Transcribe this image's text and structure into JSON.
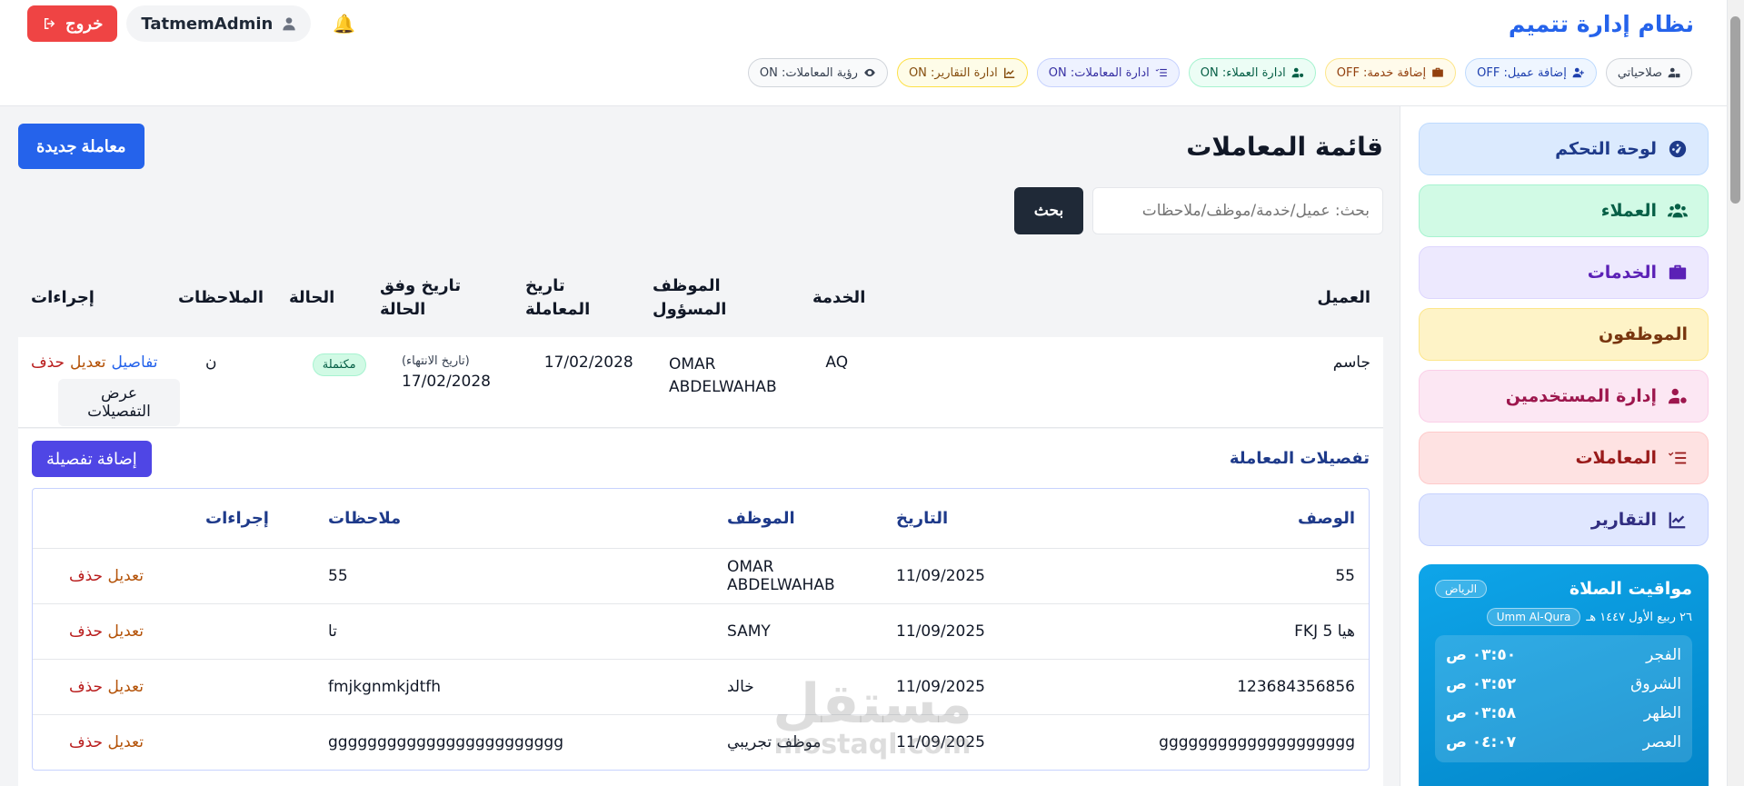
{
  "app": {
    "title": "نظام إدارة تتميم"
  },
  "header": {
    "logout_label": "خروج",
    "username": "TatmemAdmin",
    "permissions": [
      {
        "label": "صلاحياتي",
        "style": "gray",
        "icon": "user-lock-icon"
      },
      {
        "label": "إضافة عميل: OFF",
        "style": "blue",
        "icon": "user-plus-icon"
      },
      {
        "label": "إضافة خدمة: OFF",
        "style": "amber",
        "icon": "briefcase-icon"
      },
      {
        "label": "ادارة العملاء: ON",
        "style": "green",
        "icon": "user-gear-icon"
      },
      {
        "label": "ادارة المعاملات: ON",
        "style": "indigo",
        "icon": "list-check-icon"
      },
      {
        "label": "ادارة التقارير: ON",
        "style": "yellow",
        "icon": "chart-icon"
      },
      {
        "label": "رؤية المعاملات: ON",
        "style": "gray",
        "icon": "eye-icon"
      }
    ]
  },
  "sidebar": {
    "items": [
      {
        "label": "لوحة التحكم",
        "color": "blue",
        "icon": "gauge-icon"
      },
      {
        "label": "العملاء",
        "color": "green",
        "icon": "users-icon"
      },
      {
        "label": "الخدمات",
        "color": "purple",
        "icon": "briefcase-icon"
      },
      {
        "label": "الموظفون",
        "color": "yellow",
        "icon": ""
      },
      {
        "label": "إدارة المستخدمين",
        "color": "pink",
        "icon": "user-gear-icon"
      },
      {
        "label": "المعاملات",
        "color": "red",
        "icon": "list-check-icon"
      },
      {
        "label": "التقارير",
        "color": "indigo",
        "icon": "chart-icon"
      }
    ],
    "prayer": {
      "title": "مواقيت الصلاة",
      "city": "الرياض",
      "hijri_date": "٢٦ ربيع الأول ١٤٤٧ هـ",
      "calendar": "Umm Al-Qura",
      "times": [
        {
          "name": "الفجر",
          "time": "٠٣:٥٠ ص"
        },
        {
          "name": "الشروق",
          "time": "٠٣:٥٢ ص"
        },
        {
          "name": "الظهر",
          "time": "٠٣:٥٨ ص"
        },
        {
          "name": "العصر",
          "time": "٠٤:٠٧ ص"
        }
      ]
    }
  },
  "main": {
    "page_title": "قائمة المعاملات",
    "new_button": "معاملة جديدة",
    "search": {
      "placeholder": "بحث: عميل/خدمة/موظف/ملاحظات",
      "button": "بحث"
    },
    "columns": {
      "client": "العميل",
      "service": "الخدمة",
      "employee": "الموظف المسؤول",
      "tx_date": "تاريخ المعاملة",
      "state_date": "تاريخ وفق الحالة",
      "status": "الحالة",
      "notes": "الملاحظات",
      "actions": "إجراءات"
    },
    "row": {
      "client": "جاسم",
      "service": "AQ",
      "employee": "OMAR ABDELWAHAB",
      "tx_date": "17/02/2028",
      "state_date_label": "(تاريخ الانتهاء)",
      "state_date": "17/02/2028",
      "status": "مكتملة",
      "notes": "ن",
      "details_link": "تفاصيل",
      "edit_link": "تعديل",
      "delete_link": "حذف",
      "show_details": "عرض التفصيلات"
    },
    "details": {
      "title": "تفصيلات المعاملة",
      "add_button": "إضافة تفصيلة",
      "columns": {
        "desc": "الوصف",
        "date": "التاريخ",
        "employee": "الموظف",
        "notes": "ملاحظات",
        "actions": "إجراءات"
      },
      "edit_label": "تعديل",
      "delete_label": "حذف",
      "rows": [
        {
          "desc": "55",
          "date": "11/09/2025",
          "employee": "OMAR ABDELWAHAB",
          "notes": "55"
        },
        {
          "desc": "هيا FKJ 5",
          "date": "11/09/2025",
          "employee": "SAMY",
          "notes": "تا"
        },
        {
          "desc": "123684356856",
          "date": "11/09/2025",
          "employee": "خالد",
          "notes": "fmjkgnmkjdtfh"
        },
        {
          "desc": "gggggggggggggggggggg",
          "date": "11/09/2025",
          "employee": "موظف تجريبي",
          "notes": "gggggggggggggggggggggggg"
        }
      ]
    }
  },
  "watermark": {
    "arabic": "مستقل",
    "latin": "mostaql.com"
  },
  "colors": {
    "primary": "#2563eb",
    "danger": "#ef4444",
    "dark": "#1f2937",
    "indigo": "#4f46e5",
    "prayer": "#0ea5e9"
  }
}
